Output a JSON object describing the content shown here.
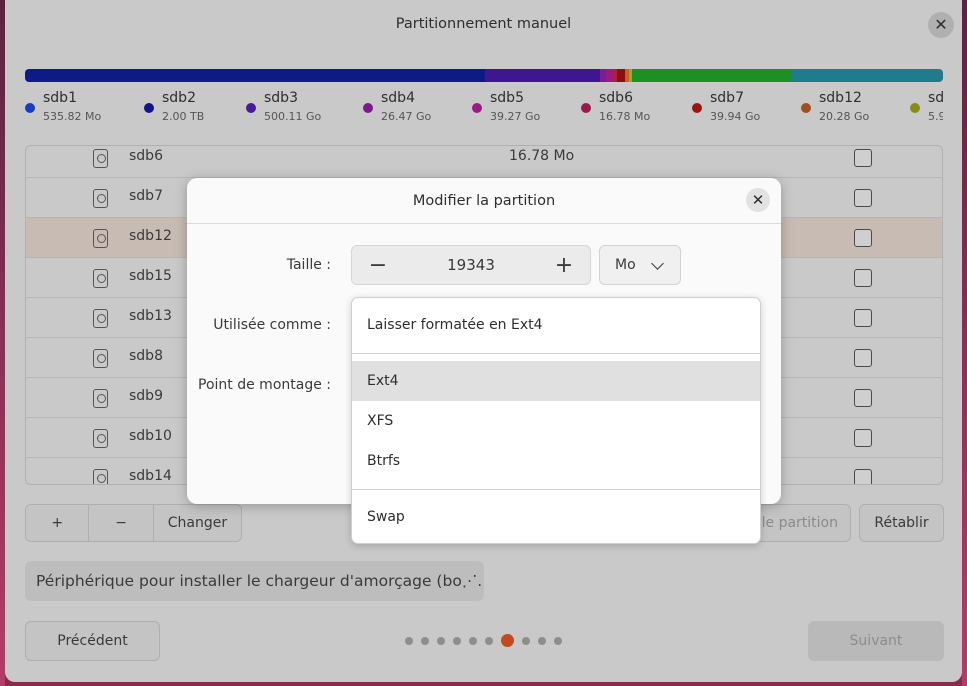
{
  "window": {
    "title": "Partitionnement manuel"
  },
  "colors": {
    "bar": [
      "#0a1880",
      "#4b1490",
      "#7b1f9a",
      "#9a1a7a",
      "#b8233a",
      "#c0311e",
      "#c8602a",
      "#b09a1c",
      "#1d8a21",
      "#1f7a8a"
    ]
  },
  "legend": [
    {
      "name": "sdb1",
      "size": "535.82 Mo",
      "color": "#1a3cc0"
    },
    {
      "name": "sdb2",
      "size": "2.00 TB",
      "color": "#14148a"
    },
    {
      "name": "sdb3",
      "size": "500.11 Go",
      "color": "#4a1a9a"
    },
    {
      "name": "sdb4",
      "size": "26.47 Go",
      "color": "#7a1a8a"
    },
    {
      "name": "sdb5",
      "size": "39.27 Go",
      "color": "#9a1a8a"
    },
    {
      "name": "sdb6",
      "size": "16.78 Mo",
      "color": "#9a1a4a"
    },
    {
      "name": "sdb7",
      "size": "39.94 Go",
      "color": "#9a1414"
    },
    {
      "name": "sdb12",
      "size": "20.28 Go",
      "color": "#a0501a"
    },
    {
      "name": "sd",
      "size": "5.9",
      "color": "#8a8a14"
    }
  ],
  "table": {
    "rows": [
      {
        "name": "sdb6",
        "size": "16.78 Mo"
      },
      {
        "name": "sdb7",
        "size": ""
      },
      {
        "name": "sdb12",
        "size": ""
      },
      {
        "name": "sdb15",
        "size": ""
      },
      {
        "name": "sdb13",
        "size": ""
      },
      {
        "name": "sdb8",
        "size": ""
      },
      {
        "name": "sdb9",
        "size": ""
      },
      {
        "name": "sdb10",
        "size": ""
      },
      {
        "name": "sdb14",
        "size": ""
      }
    ]
  },
  "buttons": {
    "add": "+",
    "remove": "−",
    "change": "Changer",
    "new_table": "le partition",
    "revert": "Rétablir",
    "previous": "Précédent",
    "next": "Suivant"
  },
  "bootloader": {
    "value": "Périphérique pour installer le chargeur d'amorçage (bo⋰."
  },
  "pager": {
    "count": 10,
    "active": 6
  },
  "dialog": {
    "title": "Modifier la partition",
    "size_label": "Taille :",
    "size_value": "19343",
    "size_minus": "−",
    "size_plus": "+",
    "unit": "Mo",
    "used_as_label": "Utilisée comme :",
    "mount_label": "Point de montage :"
  },
  "popup": {
    "current": "Laisser formatée en Ext4",
    "options": [
      "Ext4",
      "XFS",
      "Btrfs"
    ],
    "other": "Swap"
  }
}
